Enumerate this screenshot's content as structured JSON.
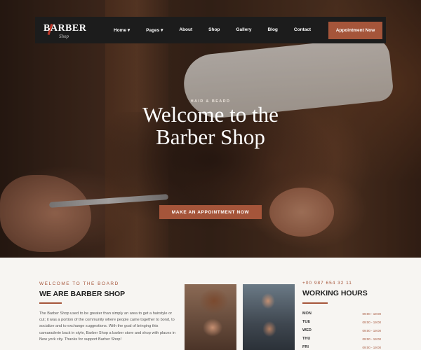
{
  "nav": {
    "logo_main": "BARBER",
    "logo_sub": "Shop",
    "items": [
      {
        "label": "Home ▾"
      },
      {
        "label": "Pages ▾"
      },
      {
        "label": "About"
      },
      {
        "label": "Shop"
      },
      {
        "label": "Gallery"
      },
      {
        "label": "Blog"
      },
      {
        "label": "Contact"
      }
    ],
    "appointment_button": "Appointment Now"
  },
  "hero": {
    "kicker": "HAIR & BEARD",
    "title_line1": "Welcome to the",
    "title_line2": "Barber Shop",
    "cta": "MAKE AN APPOINTMENT NOW"
  },
  "about": {
    "kicker": "WELCOME TO THE BOARD",
    "title": "WE ARE BARBER SHOP",
    "body": "The Barber Shop used to be greater than simply an area to get a hairstyle or cut; it was a portion of the community where people came together to bond, to socialize and to exchange suggestions. With the goal of bringing this camaraderie back in style, Barber Shop a barber store and shop with places in New york city. Thanks for support Barber Shop!"
  },
  "hours": {
    "phone": "+00 987 654 32 11",
    "title": "WORKING HOURS",
    "rows": [
      {
        "day": "MON",
        "time": "09:00 - 19:00"
      },
      {
        "day": "TUE",
        "time": "09:00 - 19:00"
      },
      {
        "day": "WED",
        "time": "09:00 - 19:00"
      },
      {
        "day": "THU",
        "time": "09:00 - 19:00"
      },
      {
        "day": "FRI",
        "time": "09:00 - 19:00"
      }
    ]
  },
  "colors": {
    "accent": "#a5553a",
    "nav_bg": "#1c1c1c",
    "section_bg": "#f7f5f2"
  }
}
